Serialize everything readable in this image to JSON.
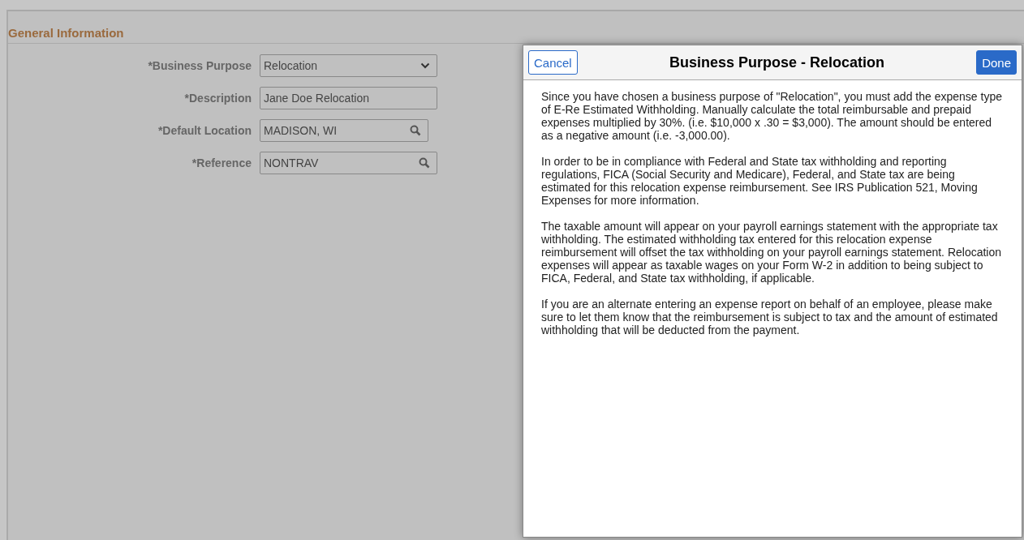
{
  "section": {
    "title": "General Information"
  },
  "fields": [
    {
      "label": "*Business Purpose",
      "kind": "select",
      "value": "Relocation"
    },
    {
      "label": "*Description",
      "kind": "text",
      "value": "Jane Doe Relocation"
    },
    {
      "label": "*Default Location",
      "kind": "lookup",
      "value": "MADISON, WI"
    },
    {
      "label": "*Reference",
      "kind": "lookup",
      "value": "NONTRAV"
    }
  ],
  "dialog": {
    "title": "Business Purpose - Relocation",
    "cancel": "Cancel",
    "done": "Done",
    "paragraphs": [
      "Since you have chosen a business purpose of \"Relocation\", you must add the expense type of E-Re Estimated Withholding. Manually calculate the total reimbursable and prepaid expenses multiplied by 30%. (i.e. $10,000 x .30 = $3,000). The amount should be entered as a negative amount (i.e. -3,000.00).",
      "In order to be in compliance with Federal and State tax withholding and reporting regulations, FICA (Social Security and Medicare), Federal, and State tax are being estimated for this relocation expense reimbursement. See IRS Publication 521, Moving Expenses for more information.",
      "The taxable amount will appear on your payroll earnings statement with the appropriate tax withholding. The estimated withholding tax entered for this relocation expense reimbursement will offset the tax withholding on your payroll earnings statement. Relocation expenses will appear as taxable wages on your Form W-2 in addition to being subject to FICA, Federal, and State tax withholding, if applicable.",
      "If you are an alternate entering an expense report on behalf of an employee, please make sure to let them know that the reimbursement is subject to tax and the amount of estimated withholding that will be deducted from the payment."
    ]
  }
}
